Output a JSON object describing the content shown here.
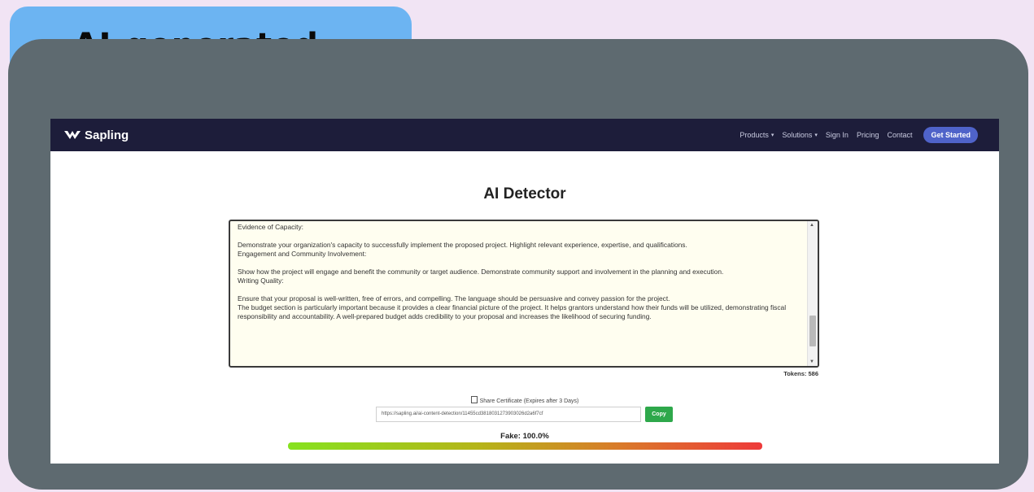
{
  "badge": {
    "label": "AI-generated"
  },
  "navbar": {
    "brand": "Sapling",
    "links": [
      {
        "label": "Products",
        "caret": "▾"
      },
      {
        "label": "Solutions",
        "caret": "▾"
      },
      {
        "label": "Sign In"
      },
      {
        "label": "Pricing"
      },
      {
        "label": "Contact"
      }
    ],
    "cta": "Get Started"
  },
  "page": {
    "title": "AI Detector"
  },
  "editor": {
    "lines": [
      "Evidence of Capacity:",
      "",
      "Demonstrate your organization's capacity to successfully implement the proposed project. Highlight relevant experience, expertise, and qualifications.",
      "Engagement and Community Involvement:",
      "",
      "Show how the project will engage and benefit the community or target audience. Demonstrate community support and involvement in the planning and execution.",
      "Writing Quality:",
      "",
      "Ensure that your proposal is well-written, free of errors, and compelling. The language should be persuasive and convey passion for the project.",
      "The budget section is particularly important because it provides a clear financial picture of the project. It helps grantors understand how their funds will be utilized, demonstrating fiscal responsibility and accountability. A well-prepared budget adds credibility to your proposal and increases the likelihood of securing funding."
    ],
    "tokens_label": "Tokens: 586"
  },
  "share": {
    "label": "Share Certificate (Expires after 3 Days)",
    "url": "https://sapling.ai/ai-content-detection/11455cd3818031273903026d2a6f7cf",
    "copy_label": "Copy"
  },
  "result": {
    "label": "Fake: 100.0%",
    "fake_fraction": 1.0
  },
  "colors": {
    "navbar": "#1d1d3a",
    "cta": "#4f63c9",
    "copy": "#2ea84b",
    "badge": "#6cb4f2",
    "frame": "#5e6a70"
  }
}
